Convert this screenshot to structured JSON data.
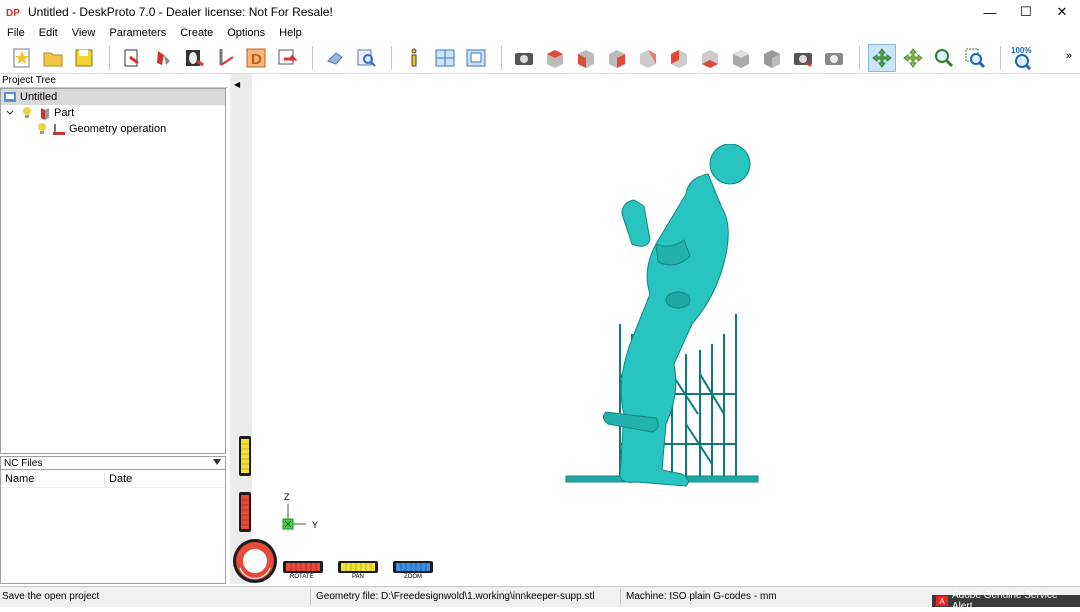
{
  "window": {
    "title": "Untitled - DeskProto 7.0 - Dealer license: Not For Resale!",
    "logo": "DP",
    "controls": {
      "minimize": "—",
      "maximize": "☐",
      "close": "✕"
    }
  },
  "menu": [
    "File",
    "Edit",
    "View",
    "Parameters",
    "Create",
    "Options",
    "Help"
  ],
  "toolbar": {
    "zoom_label": "100%",
    "more": "»"
  },
  "project_tree": {
    "title": "Project Tree",
    "root": "Untitled",
    "part": "Part",
    "operation": "Geometry operation"
  },
  "nc_files": {
    "title": "NC Files",
    "columns": [
      "Name",
      "Date"
    ]
  },
  "viewport": {
    "axis_z": "Z",
    "axis_y": "Y",
    "controls": {
      "rotate": "ROTATE",
      "pan": "PAN",
      "zoom": "ZOOM"
    },
    "model_color": "#27c4c0"
  },
  "status": {
    "hint": "Save the open project",
    "geometry": "Geometry file: D:\\Freedesignwold\\1.working\\innkeeper-supp.stl",
    "machine": "Machine: ISO plain G-codes - mm"
  },
  "notification": "Adobe Genuine Service Alert"
}
